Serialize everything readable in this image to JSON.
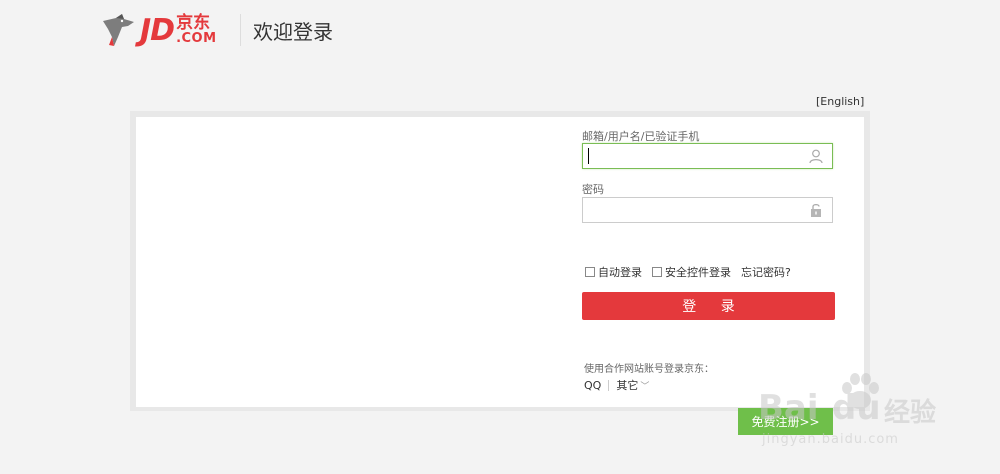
{
  "header": {
    "logo_text": "JD",
    "logo_cn": "京东",
    "logo_com": ".COM",
    "title": "欢迎登录"
  },
  "lang_link": "[English]",
  "form": {
    "username_label": "邮箱/用户名/已验证手机",
    "username_value": "",
    "password_label": "密码",
    "password_value": "",
    "auto_login_label": "自动登录",
    "secure_control_label": "安全控件登录",
    "forgot_password": "忘记密码?",
    "login_button": "登 录"
  },
  "partner": {
    "title": "使用合作网站账号登录京东：",
    "qq": "QQ",
    "other": "其它"
  },
  "register_button": "免费注册>>",
  "watermark": {
    "bai": "Bai",
    "du": "du",
    "jingyan": "经验",
    "url": "jingyan.baidu.com"
  },
  "colors": {
    "brand_red": "#e4393c",
    "focus_green": "#7abd54",
    "register_green": "#6fbf4a"
  },
  "icons": {
    "username": "user-icon",
    "password": "lock-icon",
    "logo": "jd-dog-icon"
  }
}
